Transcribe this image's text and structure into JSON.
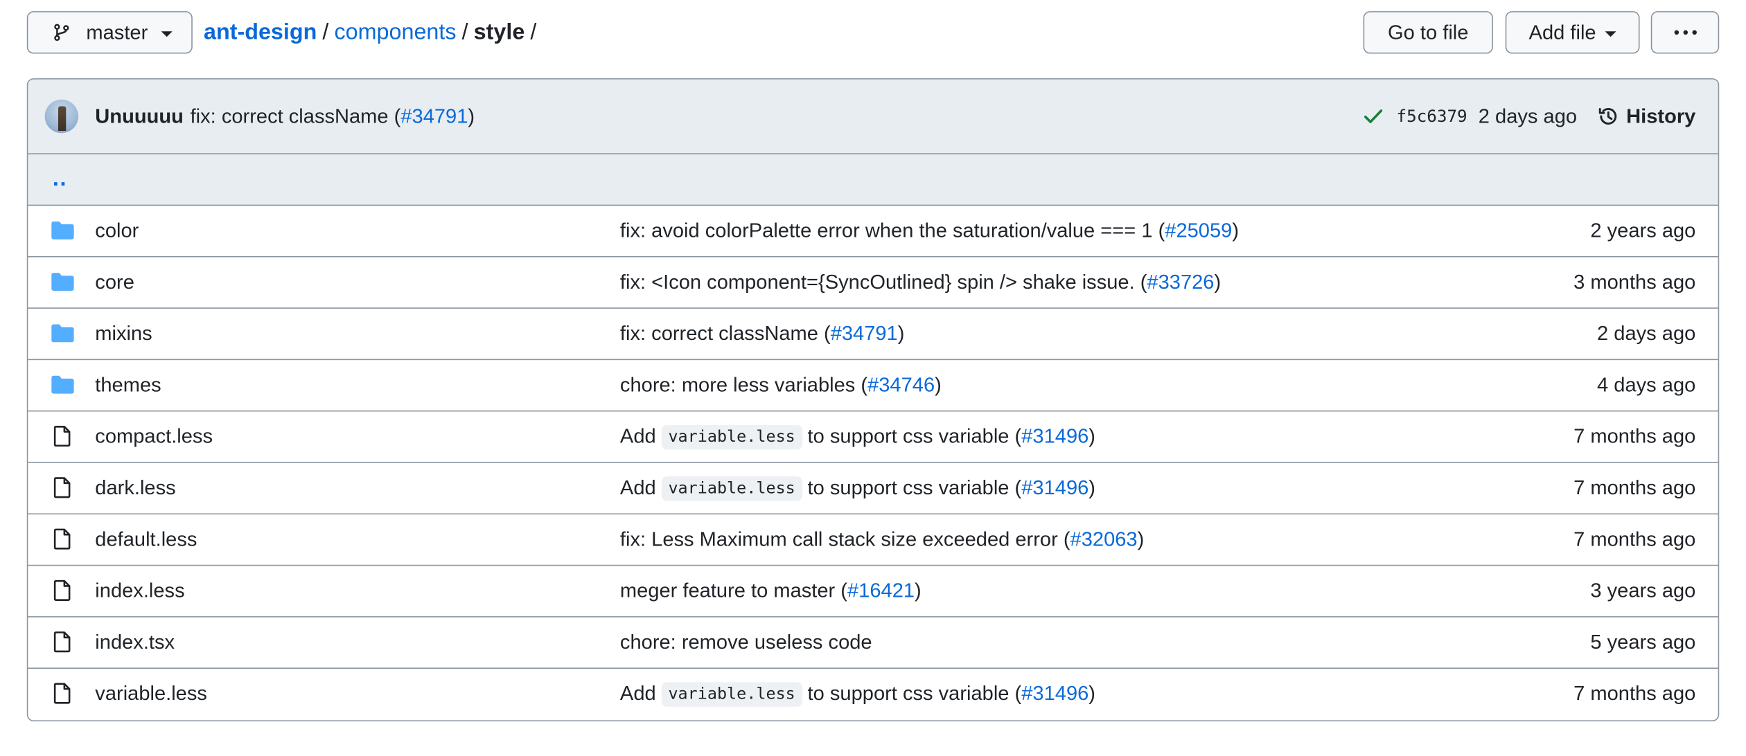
{
  "topbar": {
    "branch": "master",
    "breadcrumb": {
      "repo": "ant-design",
      "sep": "/",
      "dir": "components",
      "current": "style"
    },
    "go_to_file": "Go to file",
    "add_file": "Add file"
  },
  "commit": {
    "author": "Unuuuuu",
    "message": "fix: correct className (",
    "pr": "#34791",
    "suffix": ")",
    "sha": "f5c6379",
    "time": "2 days ago",
    "history_label": "History"
  },
  "parent_link": "..",
  "colors": {
    "link": "#0969da",
    "folder": "#54aeff",
    "check": "#1a7f37",
    "header_bg": "#e8edf2",
    "border": "#8c959f"
  },
  "files": [
    {
      "type": "folder",
      "name": "color",
      "msg_pre": "fix: avoid colorPalette error when the saturation/value === 1 (",
      "code": "",
      "msg_mid": "",
      "pr": "#25059",
      "msg_post": ")",
      "time": "2 years ago"
    },
    {
      "type": "folder",
      "name": "core",
      "msg_pre": "fix: <Icon component={SyncOutlined} spin /> shake issue. (",
      "code": "",
      "msg_mid": "",
      "pr": "#33726",
      "msg_post": ")",
      "time": "3 months ago"
    },
    {
      "type": "folder",
      "name": "mixins",
      "msg_pre": "fix: correct className (",
      "code": "",
      "msg_mid": "",
      "pr": "#34791",
      "msg_post": ")",
      "time": "2 days ago"
    },
    {
      "type": "folder",
      "name": "themes",
      "msg_pre": "chore: more less variables (",
      "code": "",
      "msg_mid": "",
      "pr": "#34746",
      "msg_post": ")",
      "time": "4 days ago"
    },
    {
      "type": "file",
      "name": "compact.less",
      "msg_pre": "Add",
      "code": "variable.less",
      "msg_mid": "to support css variable (",
      "pr": "#31496",
      "msg_post": ")",
      "time": "7 months ago"
    },
    {
      "type": "file",
      "name": "dark.less",
      "msg_pre": "Add",
      "code": "variable.less",
      "msg_mid": "to support css variable (",
      "pr": "#31496",
      "msg_post": ")",
      "time": "7 months ago"
    },
    {
      "type": "file",
      "name": "default.less",
      "msg_pre": "fix: Less Maximum call stack size exceeded error (",
      "code": "",
      "msg_mid": "",
      "pr": "#32063",
      "msg_post": ")",
      "time": "7 months ago"
    },
    {
      "type": "file",
      "name": "index.less",
      "msg_pre": "meger feature to master (",
      "code": "",
      "msg_mid": "",
      "pr": "#16421",
      "msg_post": ")",
      "time": "3 years ago"
    },
    {
      "type": "file",
      "name": "index.tsx",
      "msg_pre": "chore: remove useless code",
      "code": "",
      "msg_mid": "",
      "pr": "",
      "msg_post": "",
      "time": "5 years ago"
    },
    {
      "type": "file",
      "name": "variable.less",
      "msg_pre": "Add",
      "code": "variable.less",
      "msg_mid": "to support css variable (",
      "pr": "#31496",
      "msg_post": ")",
      "time": "7 months ago"
    }
  ]
}
